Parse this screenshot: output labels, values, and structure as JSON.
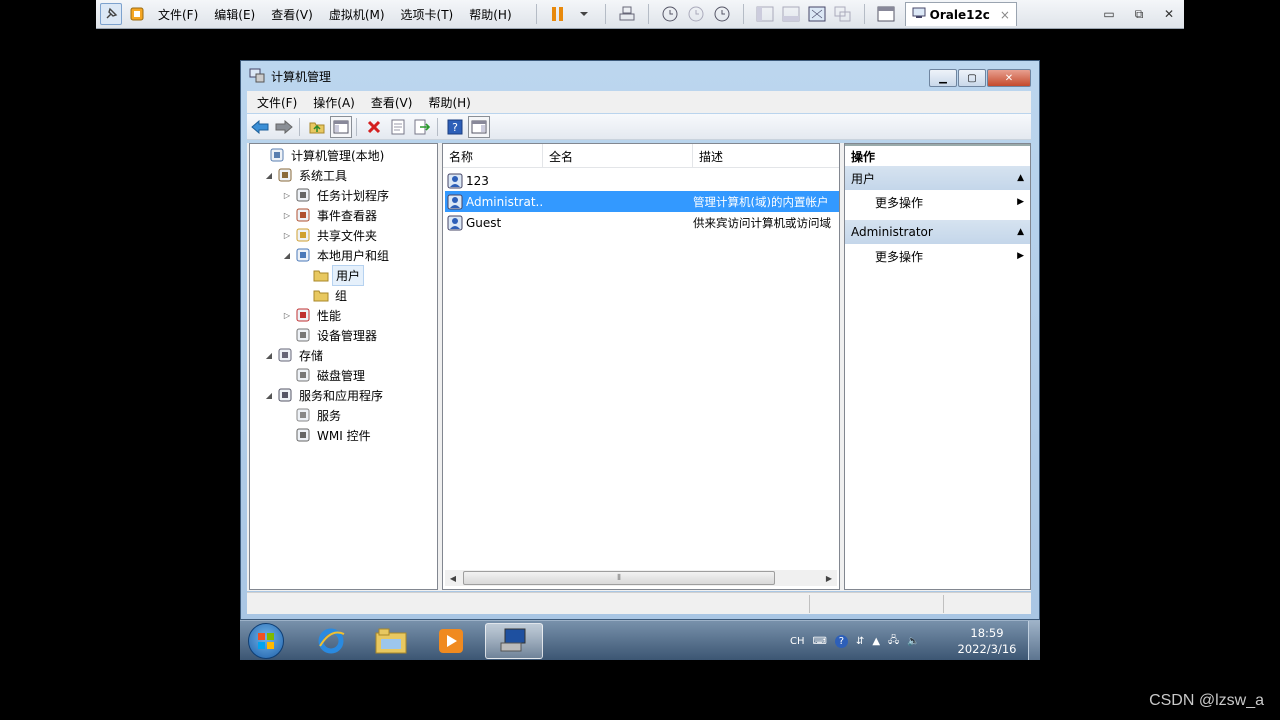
{
  "vmware": {
    "menu": [
      "文件(F)",
      "编辑(E)",
      "查看(V)",
      "虚拟机(M)",
      "选项卡(T)",
      "帮助(H)"
    ],
    "tab_label": "Orale12c",
    "tab_close": "×"
  },
  "window": {
    "title": "计算机管理",
    "menu": [
      "文件(F)",
      "操作(A)",
      "查看(V)",
      "帮助(H)"
    ]
  },
  "tree": {
    "items": [
      {
        "label": "计算机管理(本地)",
        "level": 0,
        "expander": "",
        "icon": "computer-management-icon"
      },
      {
        "label": "系统工具",
        "level": 1,
        "expander": "◢",
        "icon": "system-tools-icon"
      },
      {
        "label": "任务计划程序",
        "level": 2,
        "expander": "▷",
        "icon": "task-scheduler-icon"
      },
      {
        "label": "事件查看器",
        "level": 2,
        "expander": "▷",
        "icon": "event-viewer-icon"
      },
      {
        "label": "共享文件夹",
        "level": 2,
        "expander": "▷",
        "icon": "shared-folders-icon"
      },
      {
        "label": "本地用户和组",
        "level": 2,
        "expander": "◢",
        "icon": "local-users-groups-icon"
      },
      {
        "label": "用户",
        "level": 3,
        "expander": "",
        "icon": "folder-icon",
        "selected": true
      },
      {
        "label": "组",
        "level": 3,
        "expander": "",
        "icon": "folder-icon"
      },
      {
        "label": "性能",
        "level": 2,
        "expander": "▷",
        "icon": "performance-icon"
      },
      {
        "label": "设备管理器",
        "level": 2,
        "expander": "",
        "icon": "device-manager-icon"
      },
      {
        "label": "存储",
        "level": 1,
        "expander": "◢",
        "icon": "storage-icon"
      },
      {
        "label": "磁盘管理",
        "level": 2,
        "expander": "",
        "icon": "disk-management-icon"
      },
      {
        "label": "服务和应用程序",
        "level": 1,
        "expander": "◢",
        "icon": "services-apps-icon"
      },
      {
        "label": "服务",
        "level": 2,
        "expander": "",
        "icon": "services-icon"
      },
      {
        "label": "WMI 控件",
        "level": 2,
        "expander": "",
        "icon": "wmi-control-icon"
      }
    ]
  },
  "list": {
    "columns": [
      "名称",
      "全名",
      "描述"
    ],
    "rows": [
      {
        "name": "123",
        "fullname": "",
        "description": "",
        "selected": false
      },
      {
        "name": "Administrat...",
        "fullname": "",
        "description": "管理计算机(域)的内置帐户",
        "selected": true
      },
      {
        "name": "Guest",
        "fullname": "",
        "description": "供来宾访问计算机或访问域",
        "selected": false
      }
    ]
  },
  "actions": {
    "header": "操作",
    "groups": [
      {
        "title": "用户",
        "item": "更多操作"
      },
      {
        "title": "Administrator",
        "item": "更多操作"
      }
    ]
  },
  "taskbar": {
    "lang": "CH",
    "time": "18:59",
    "date": "2022/3/16"
  },
  "watermark": "CSDN @lzsw_a",
  "colors": {
    "selection": "#3399ff",
    "taskbar": "#3c5673"
  }
}
